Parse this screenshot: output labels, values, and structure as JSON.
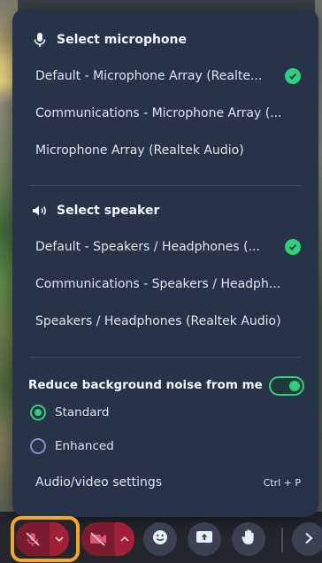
{
  "microphone": {
    "heading": "Select microphone",
    "options": [
      {
        "label": "Default - Microphone Array (Realte...",
        "selected": true
      },
      {
        "label": "Communications - Microphone Array (...",
        "selected": false
      },
      {
        "label": "Microphone Array (Realtek Audio)",
        "selected": false
      }
    ]
  },
  "speaker": {
    "heading": "Select speaker",
    "options": [
      {
        "label": "Default - Speakers / Headphones (...",
        "selected": true
      },
      {
        "label": "Communications - Speakers / Headph...",
        "selected": false
      },
      {
        "label": "Speakers / Headphones (Realtek Audio)",
        "selected": false
      }
    ]
  },
  "noise": {
    "label": "Reduce background noise from me",
    "enabled": true,
    "options": [
      {
        "label": "Standard",
        "selected": true
      },
      {
        "label": "Enhanced",
        "selected": false
      }
    ]
  },
  "settings": {
    "label": "Audio/video settings",
    "shortcut": "Ctrl + P"
  },
  "colors": {
    "menu_bg": "#263348",
    "accent": "#2fd07c",
    "mute_red": "#a11f37",
    "highlight": "#f5a623"
  },
  "toolbar": {
    "buttons": [
      "mic-muted",
      "mic-options",
      "camera-off",
      "camera-options",
      "reactions",
      "share-screen",
      "raise-hand",
      "more"
    ]
  }
}
